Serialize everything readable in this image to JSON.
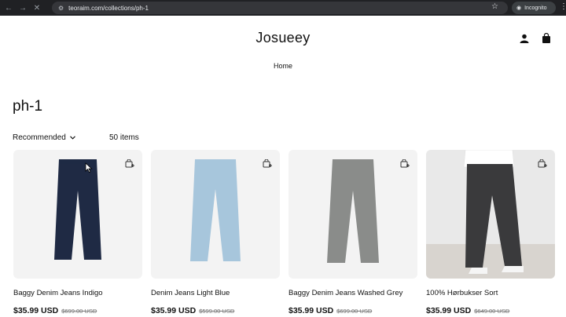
{
  "browser": {
    "url": "teoraim.com/collections/ph-1",
    "profile_label": "Incognito"
  },
  "store": {
    "brand": "Josueey",
    "nav": {
      "home_label": "Home"
    }
  },
  "collection": {
    "title": "ph-1",
    "sort_label": "Recommended",
    "item_count": "50 items"
  },
  "products": [
    {
      "name": "Baggy Denim Jeans Indigo",
      "price": "$35.99 USD",
      "compare_price": "$699.00 USD",
      "color": "#1f2a44"
    },
    {
      "name": "Denim Jeans Light Blue",
      "price": "$35.99 USD",
      "compare_price": "$599.00 USD",
      "color": "#a7c6dc"
    },
    {
      "name": "Baggy Denim Jeans Washed Grey",
      "price": "$35.99 USD",
      "compare_price": "$699.00 USD",
      "color": "#8a8c8a"
    },
    {
      "name": "100% Hørbukser Sort",
      "price": "$35.99 USD",
      "compare_price": "$649.00 USD",
      "color": "#3a3a3c"
    }
  ],
  "icons": {
    "account": "person-icon",
    "cart": "shopping-bag-icon",
    "quick_add": "quick-add-bag-icon",
    "sort_chevron": "chevron-down-icon"
  }
}
